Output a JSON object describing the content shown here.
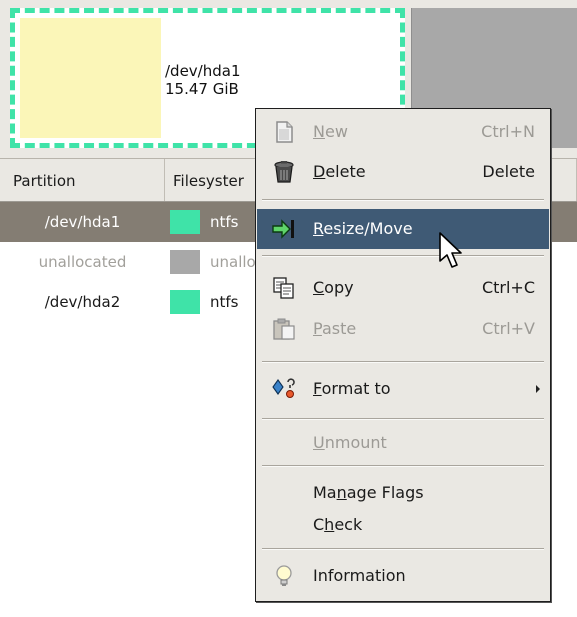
{
  "visualizer": {
    "partition": {
      "name": "/dev/hda1",
      "size": "15.47 GiB"
    },
    "colors": {
      "used": "#fbf6b8",
      "unused": "#ffffff",
      "border": "#3fe3a8",
      "unallocated": "#a8a8a8"
    }
  },
  "table": {
    "headers": {
      "partition": "Partition",
      "filesystem": "Filesyster"
    },
    "rows": [
      {
        "partition": "/dev/hda1",
        "fs_color": "#3fe3a8",
        "filesystem": "ntfs",
        "selected": true
      },
      {
        "partition": "unallocated",
        "fs_color": "#a8a8a8",
        "filesystem": "unallo",
        "dimmed": true
      },
      {
        "partition": "/dev/hda2",
        "fs_color": "#3fe3a8",
        "filesystem": "ntfs"
      }
    ]
  },
  "menu": {
    "new": {
      "label_u": "N",
      "label_rest": "ew",
      "accel": "Ctrl+N",
      "icon": "new-document-icon"
    },
    "delete": {
      "label_u": "D",
      "label_rest": "elete",
      "accel": "Delete",
      "icon": "trash-icon"
    },
    "resize": {
      "label_u": "R",
      "label_rest": "esize/Move",
      "icon": "resize-arrow-icon"
    },
    "copy": {
      "label_u": "C",
      "label_rest": "opy",
      "accel": "Ctrl+C",
      "icon": "copy-icon"
    },
    "paste": {
      "label_u": "P",
      "label_rest": "aste",
      "accel": "Ctrl+V",
      "icon": "paste-icon"
    },
    "format": {
      "label_u": "F",
      "label_rest": "ormat to",
      "icon": "format-icon"
    },
    "unmount": {
      "label_u": "U",
      "label_rest": "nmount"
    },
    "manage_flags": {
      "label_pre": "Ma",
      "label_u": "n",
      "label_rest": "age Flags"
    },
    "check": {
      "label_pre": "C",
      "label_u": "h",
      "label_rest": "eck"
    },
    "information": {
      "label": "Information",
      "icon": "lightbulb-icon"
    }
  }
}
